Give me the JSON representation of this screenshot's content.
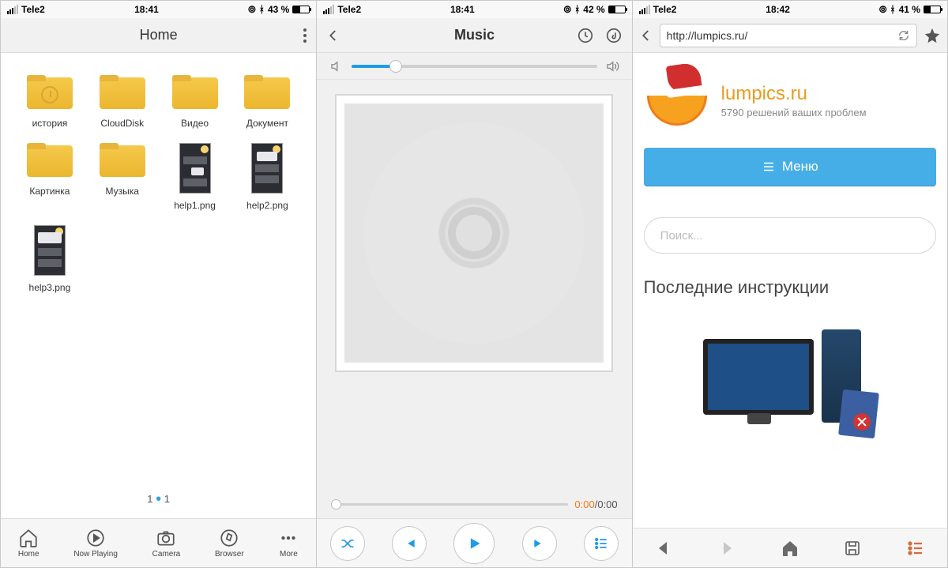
{
  "screen1": {
    "status": {
      "carrier": "Tele2",
      "time": "18:41",
      "battery": "43 %",
      "battery_fill": 43
    },
    "header": {
      "title": "Home"
    },
    "items": [
      {
        "label": "история",
        "type": "folder-history"
      },
      {
        "label": "CloudDisk",
        "type": "folder"
      },
      {
        "label": "Видео",
        "type": "folder"
      },
      {
        "label": "Документ",
        "type": "folder"
      },
      {
        "label": "Картинка",
        "type": "folder"
      },
      {
        "label": "Музыка",
        "type": "folder"
      },
      {
        "label": "help1.png",
        "type": "thumb"
      },
      {
        "label": "help2.png",
        "type": "thumb"
      },
      {
        "label": "help3.png",
        "type": "thumb"
      }
    ],
    "pager": {
      "current": "1",
      "total": "1"
    },
    "tabs": [
      {
        "label": "Home"
      },
      {
        "label": "Now Playing"
      },
      {
        "label": "Camera"
      },
      {
        "label": "Browser"
      },
      {
        "label": "More"
      }
    ]
  },
  "screen2": {
    "status": {
      "carrier": "Tele2",
      "time": "18:41",
      "battery": "42 %",
      "battery_fill": 42
    },
    "header": {
      "title": "Music"
    },
    "volume_pct": 18,
    "time": {
      "current": "0:00",
      "total": "0:00"
    }
  },
  "screen3": {
    "status": {
      "carrier": "Tele2",
      "time": "18:42",
      "battery": "41 %",
      "battery_fill": 41
    },
    "url": "http://lumpics.ru/",
    "site": {
      "name": "lumpics.ru",
      "tagline": "5790 решений ваших проблем"
    },
    "menu_label": "Меню",
    "search_placeholder": "Поиск...",
    "section_heading": "Последние инструкции"
  }
}
